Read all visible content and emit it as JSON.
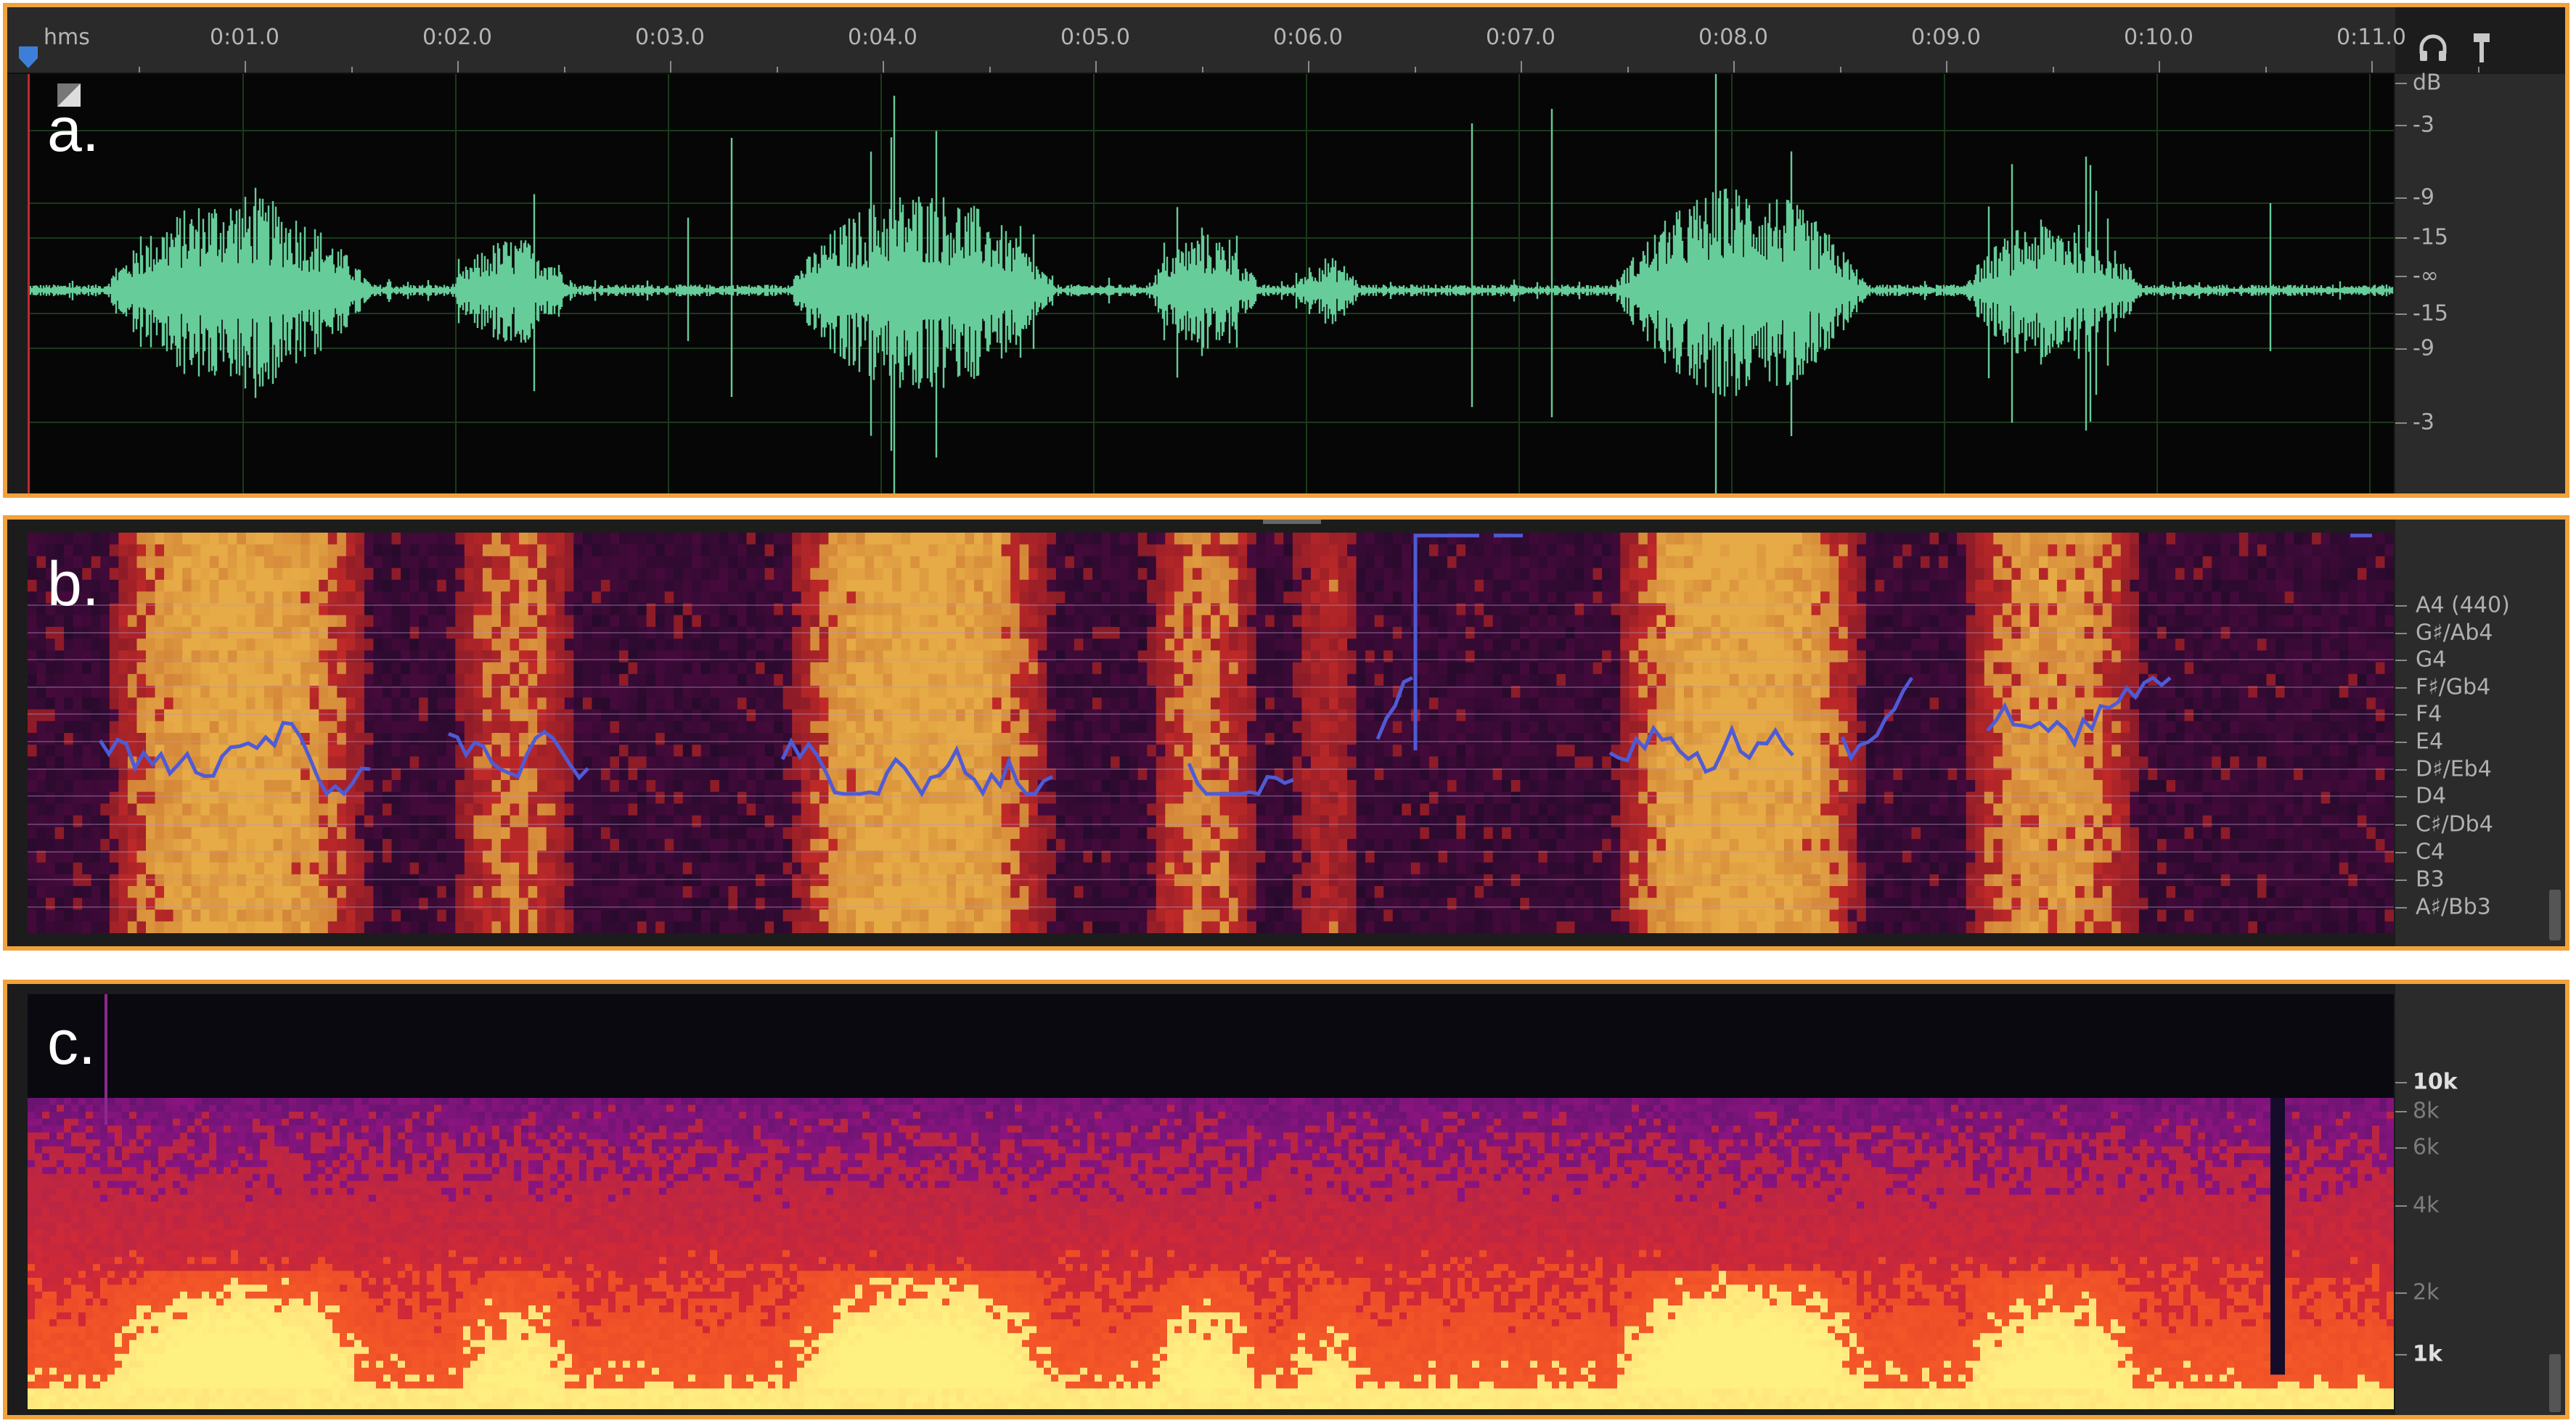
{
  "panel_a": {
    "letter": "a.",
    "ruler": {
      "unit_label": "hms",
      "ticks": [
        "0:01.0",
        "0:02.0",
        "0:03.0",
        "0:04.0",
        "0:05.0",
        "0:06.0",
        "0:07.0",
        "0:08.0",
        "0:09.0",
        "0:10.0",
        "0:11.0"
      ]
    },
    "db_scale": [
      "dB",
      "-3",
      "-9",
      "-15",
      "-∞",
      "-15",
      "-9",
      "-3"
    ],
    "waveform_color": "#66cc99",
    "icons": [
      "headphones-icon",
      "marker-pin-icon"
    ]
  },
  "panel_b": {
    "letter": "b.",
    "note_scale": [
      "A4 (440)",
      "G♯/Ab4",
      "G4",
      "F♯/Gb4",
      "F4",
      "E4",
      "D♯/Eb4",
      "D4",
      "C♯/Db4",
      "C4",
      "B3",
      "A♯/Bb3"
    ],
    "pitch_line_color": "#4f5bd6"
  },
  "panel_c": {
    "letter": "c.",
    "freq_scale": [
      "10k",
      "8k",
      "6k",
      "4k",
      "2k",
      "1k"
    ]
  },
  "colors": {
    "accent_border": "#f2a23a",
    "waveform": "#66cc99",
    "pitch": "#4f5bd6"
  }
}
